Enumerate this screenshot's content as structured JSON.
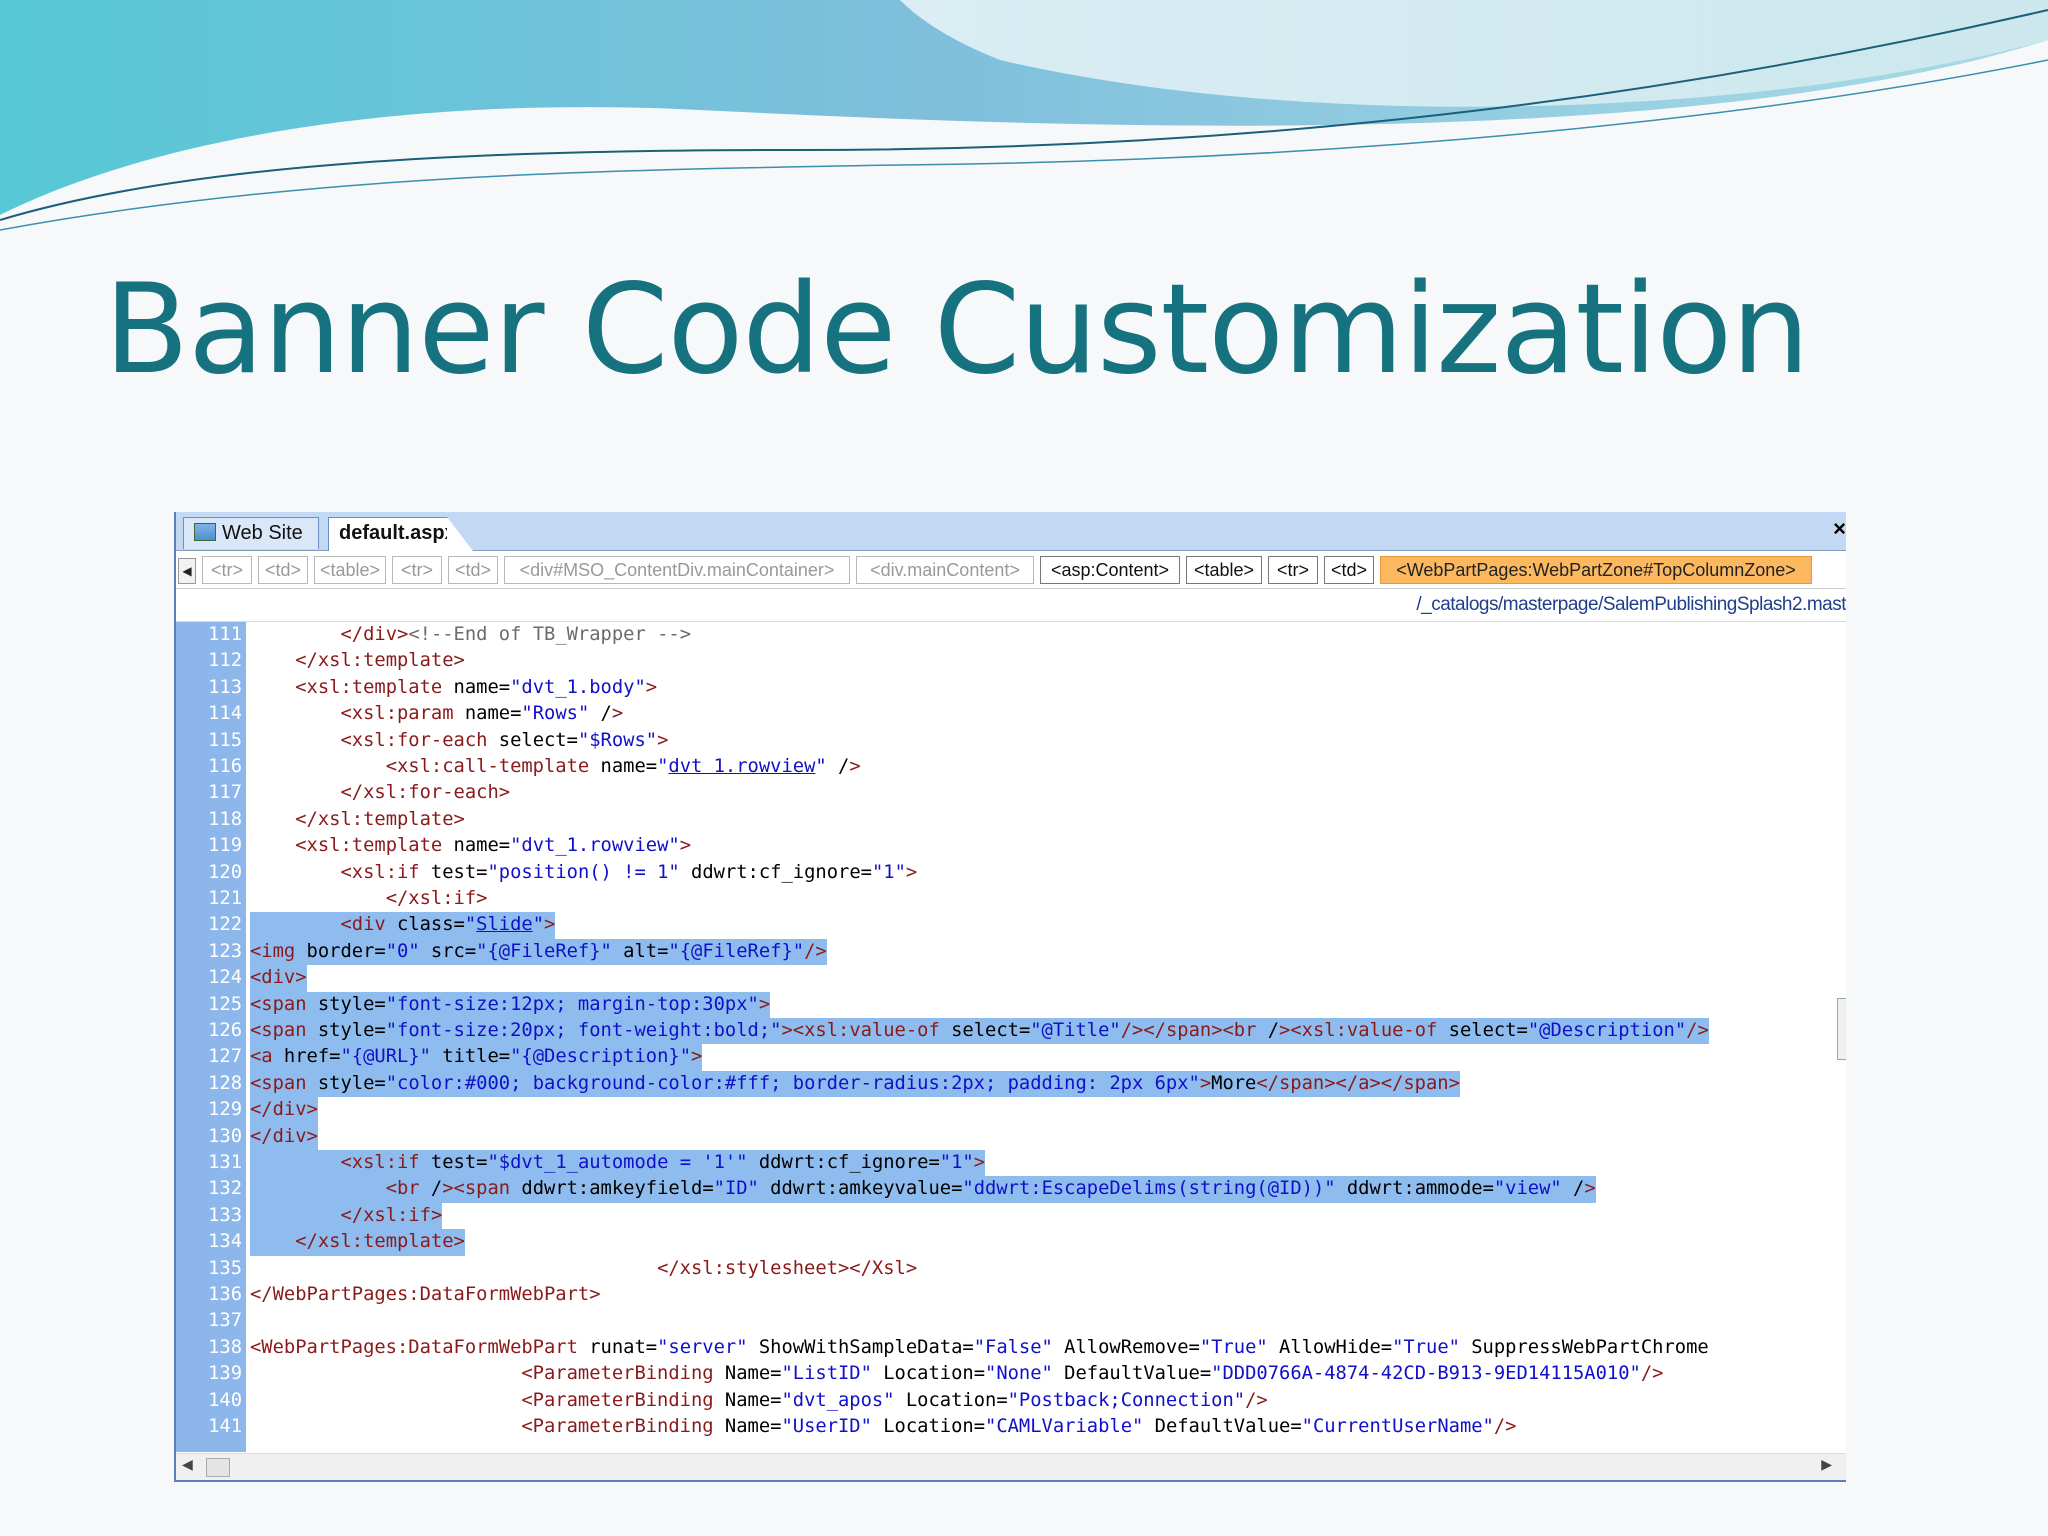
{
  "slide": {
    "title": "Banner Code Customization"
  },
  "editor": {
    "tabs": [
      {
        "label": "Web Site",
        "icon": "website-icon"
      },
      {
        "label": "default.aspx"
      }
    ],
    "close_glyph": "×",
    "tag_breadcrumbs": [
      "<tr>",
      "<td>",
      "<table>",
      "<tr>",
      "<td>",
      "<div#MSO_ContentDiv.mainContainer>",
      "<div.mainContent>",
      "<asp:Content>",
      "<table>",
      "<tr>",
      "<td>",
      "<WebPartPages:WebPartZone#TopColumnZone>"
    ],
    "selected_tag": "<WebPartPages:WebPartZone#TopColumnZone>",
    "file_path": "/_catalogs/masterpage/SalemPublishingSplash2.mast",
    "code_lines": [
      {
        "n": "111",
        "text": "        </div><!--End of TB_Wrapper -->"
      },
      {
        "n": "112",
        "text": "    </xsl:template>"
      },
      {
        "n": "113",
        "text": "    <xsl:template name=\"dvt_1.body\">"
      },
      {
        "n": "114",
        "text": "        <xsl:param name=\"Rows\" />"
      },
      {
        "n": "115",
        "text": "        <xsl:for-each select=\"$Rows\">"
      },
      {
        "n": "116",
        "text": "            <xsl:call-template name=\"dvt 1.rowview\" />"
      },
      {
        "n": "117",
        "text": "        </xsl:for-each>"
      },
      {
        "n": "118",
        "text": "    </xsl:template>"
      },
      {
        "n": "119",
        "text": "    <xsl:template name=\"dvt_1.rowview\">"
      },
      {
        "n": "120",
        "text": "        <xsl:if test=\"position() != 1\" ddwrt:cf_ignore=\"1\">"
      },
      {
        "n": "121",
        "text": "            </xsl:if>"
      },
      {
        "n": "122",
        "text": "        <div class=\"Slide\">"
      },
      {
        "n": "123",
        "text": "<img border=\"0\" src=\"{@FileRef}\" alt=\"{@FileRef}\"/>"
      },
      {
        "n": "124",
        "text": "<div>"
      },
      {
        "n": "125",
        "text": "<span style=\"font-size:12px; margin-top:30px\">"
      },
      {
        "n": "126",
        "text": "<span style=\"font-size:20px; font-weight:bold;\"><xsl:value-of select=\"@Title\"/></span><br /><xsl:value-of select=\"@Description\"/>"
      },
      {
        "n": "127",
        "text": "<a href=\"{@URL}\" title=\"{@Description}\">"
      },
      {
        "n": "128",
        "text": "<span style=\"color:#000; background-color:#fff; border-radius:2px; padding: 2px 6px\">More</span></a></span>"
      },
      {
        "n": "129",
        "text": "</div>"
      },
      {
        "n": "130",
        "text": "</div>"
      },
      {
        "n": "131",
        "text": "        <xsl:if test=\"$dvt_1_automode = '1'\" ddwrt:cf_ignore=\"1\">"
      },
      {
        "n": "132",
        "text": "            <br /><span ddwrt:amkeyfield=\"ID\" ddwrt:amkeyvalue=\"ddwrt:EscapeDelims(string(@ID))\" ddwrt:ammode=\"view\" />"
      },
      {
        "n": "133",
        "text": "        </xsl:if>"
      },
      {
        "n": "134",
        "text": "    </xsl:template>"
      },
      {
        "n": "135",
        "text": "                                    </xsl:stylesheet></Xsl>"
      },
      {
        "n": "136",
        "text": "</WebPartPages:DataFormWebPart>"
      },
      {
        "n": "137",
        "text": ""
      },
      {
        "n": "138",
        "text": "<WebPartPages:DataFormWebPart runat=\"server\" ShowWithSampleData=\"False\" AllowRemove=\"True\" AllowHide=\"True\" SuppressWebPartChrome"
      },
      {
        "n": "139",
        "text": "                        <ParameterBinding Name=\"ListID\" Location=\"None\" DefaultValue=\"DDD0766A-4874-42CD-B913-9ED14115A010\"/>"
      },
      {
        "n": "140",
        "text": "                        <ParameterBinding Name=\"dvt_apos\" Location=\"Postback;Connection\"/>"
      },
      {
        "n": "141",
        "text": "                        <ParameterBinding Name=\"UserID\" Location=\"CAMLVariable\" DefaultValue=\"CurrentUserName\"/>"
      }
    ],
    "highlighted_lines": [
      "122",
      "123",
      "124",
      "125",
      "126",
      "127",
      "128",
      "129",
      "130",
      "131",
      "132",
      "133",
      "134"
    ]
  }
}
